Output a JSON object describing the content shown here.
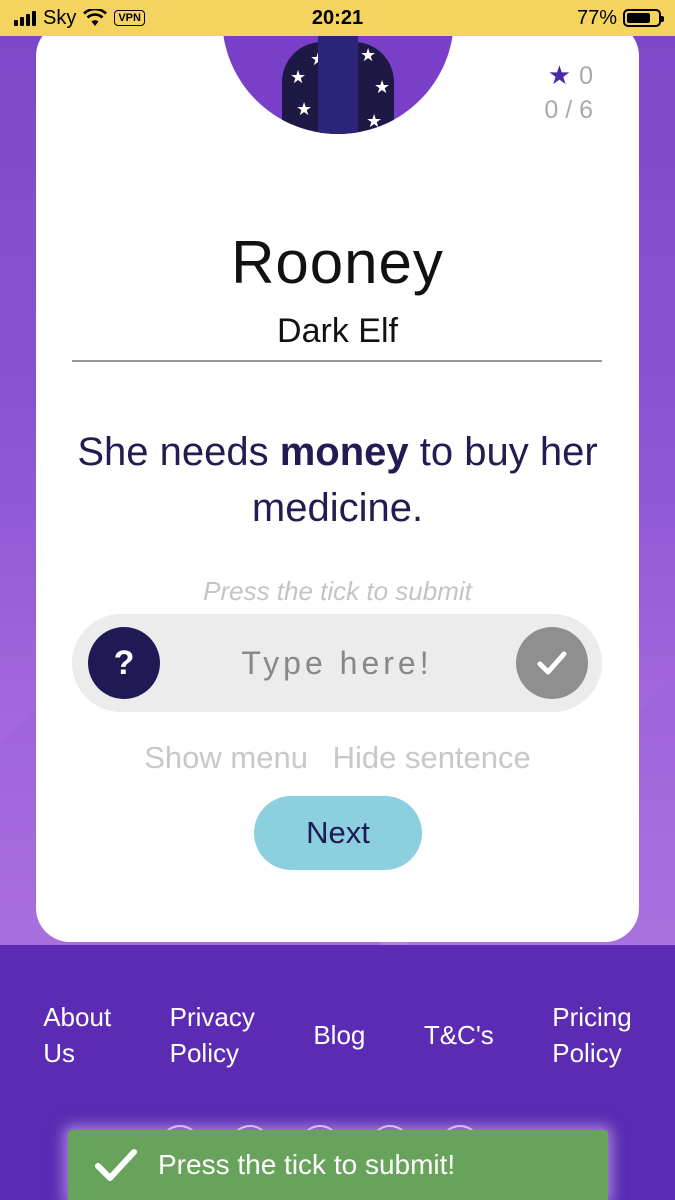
{
  "status_bar": {
    "carrier": "Sky",
    "vpn_badge": "VPN",
    "time": "20:21",
    "battery_text": "77%",
    "battery_level": 0.77
  },
  "score": {
    "stars": "0",
    "progress": "0 / 6"
  },
  "character": {
    "name": "Rooney",
    "class": "Dark Elf"
  },
  "sentence": {
    "before": "She needs ",
    "bold": "money",
    "after": " to buy her medicine."
  },
  "hint": "Press the tick to submit",
  "answer": {
    "placeholder": "Type here!",
    "value": "",
    "help_label": "?"
  },
  "links": {
    "show_menu": "Show menu",
    "hide_sentence": "Hide sentence"
  },
  "next_label": "Next",
  "footer": {
    "nav": [
      {
        "line1": "About",
        "line2": "Us"
      },
      {
        "line1": "Privacy",
        "line2": "Policy"
      },
      {
        "line1": "Blog",
        "line2": ""
      },
      {
        "line1": "T&C's",
        "line2": ""
      },
      {
        "line1": "Pricing",
        "line2": "Policy"
      }
    ]
  },
  "toast": {
    "message": "Press the tick to submit!"
  },
  "colors": {
    "status_bar": "#f5d35f",
    "accent_dark": "#1f1a55",
    "next_button": "#8ccfdf",
    "footer": "#5b2bb3",
    "toast": "#67a35a"
  }
}
